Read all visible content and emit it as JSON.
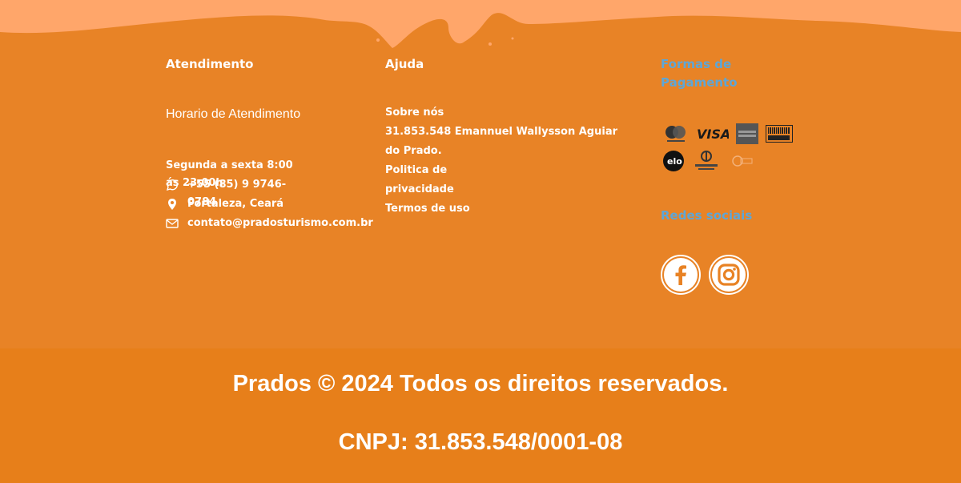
{
  "colors": {
    "background": "#E88224",
    "top_wave": "#FFA66A",
    "heading_blue": "#5EA6D6",
    "text": "#FFFFFF"
  },
  "atendimento": {
    "heading": "Atendimento",
    "hours_title": "Horario de Atendimento",
    "hours_text": "Segunda a sexta 8:00 ás 23:00h",
    "contacts": [
      {
        "icon": "whatsapp-icon",
        "text": "+55 (85) 9 9746-0784"
      },
      {
        "icon": "location-pin-icon",
        "text": "Fortaleza, Ceará"
      },
      {
        "icon": "mail-icon",
        "text": "contato@pradosturismo.com.br"
      }
    ]
  },
  "ajuda": {
    "heading": "Ajuda",
    "links": [
      "Sobre nós",
      "31.853.548 Emannuel Wallysson Aguiar do Prado.",
      "Politica de privacidade",
      "Termos de uso"
    ]
  },
  "pagamento": {
    "heading": "Formas de Pagamento",
    "methods": [
      "mastercard-icon",
      "visa-icon",
      "amex-icon",
      "boleto-icon",
      "elo-icon",
      "diners-club-icon",
      "hipercard-icon"
    ]
  },
  "social": {
    "heading": "Redes sociais",
    "items": [
      {
        "icon": "facebook-icon"
      },
      {
        "icon": "instagram-icon"
      }
    ]
  },
  "footer": {
    "copyright": "Prados © 2024 Todos os direitos reservados.",
    "cnpj": "CNPJ: 31.853.548/0001-08"
  }
}
